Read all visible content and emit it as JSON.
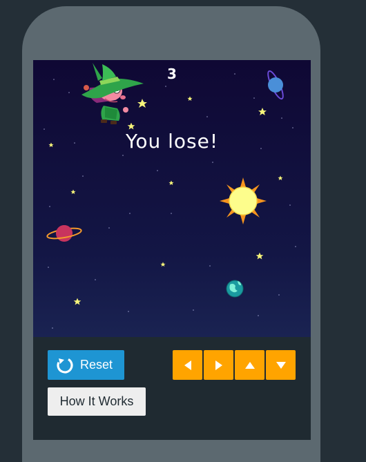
{
  "game": {
    "score": "3",
    "status_message": "You lose!"
  },
  "controls": {
    "reset_label": "Reset",
    "how_it_works_label": "How It Works",
    "arrow_buttons": [
      "left",
      "right",
      "up",
      "down"
    ]
  },
  "icons": {
    "reset": "refresh-icon",
    "left": "arrow-left-icon",
    "right": "arrow-right-icon",
    "up": "arrow-up-icon",
    "down": "arrow-down-icon"
  },
  "colors": {
    "page_background": "#242f37",
    "phone_body": "#5c6970",
    "panel": "#1f2a31",
    "sky_top": "#0f0834",
    "sky_bottom": "#1a2352",
    "reset_button": "#1e95d3",
    "arrow_button": "#ffa400",
    "how_button": "#eeeeee",
    "star": "#f7f57a",
    "sun": "#fdfd8c"
  }
}
